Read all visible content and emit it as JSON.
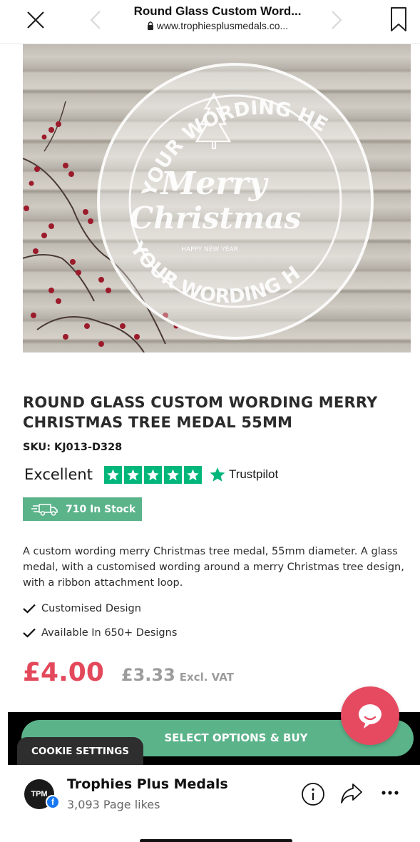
{
  "browser": {
    "title": "Round Glass Custom Word...",
    "url": "www.trophiesplusmedals.co..."
  },
  "product": {
    "title": "ROUND GLASS CUSTOM WORDING MERRY CHRISTMAS TREE MEDAL 55MM",
    "sku": "SKU: KJ013-D328",
    "rating_word": "Excellent",
    "rating_stars": 5,
    "rating_provider": "Trustpilot",
    "stock": "710 In Stock",
    "description": "A custom wording merry Christmas tree medal, 55mm diameter. A glass medal, with a customised wording around a merry Christmas tree design, with a ribbon attachment loop.",
    "features": [
      "Customised Design",
      "Available In 650+ Designs"
    ],
    "price": "£4.00",
    "price_ex_vat": "£3.33",
    "ex_vat_label": "Excl. VAT"
  },
  "medal_image": {
    "top_text": "YOUR WORDING HERE",
    "bottom_text": "YOUR WORDING HERE",
    "line1": "Merry",
    "line2": "Christmas",
    "small_text": "HAPPY NEW YEAR"
  },
  "actions": {
    "buy_label": "SELECT OPTIONS & BUY",
    "cookie_label": "COOKIE SETTINGS"
  },
  "page": {
    "avatar_text": "TPM",
    "name": "Trophies Plus Medals",
    "likes": "3,093 Page likes"
  },
  "colors": {
    "accent_green": "#5bb38a",
    "price_red": "#e3485b",
    "trustpilot_green": "#00b67a",
    "chat_pink": "#e64a61"
  }
}
